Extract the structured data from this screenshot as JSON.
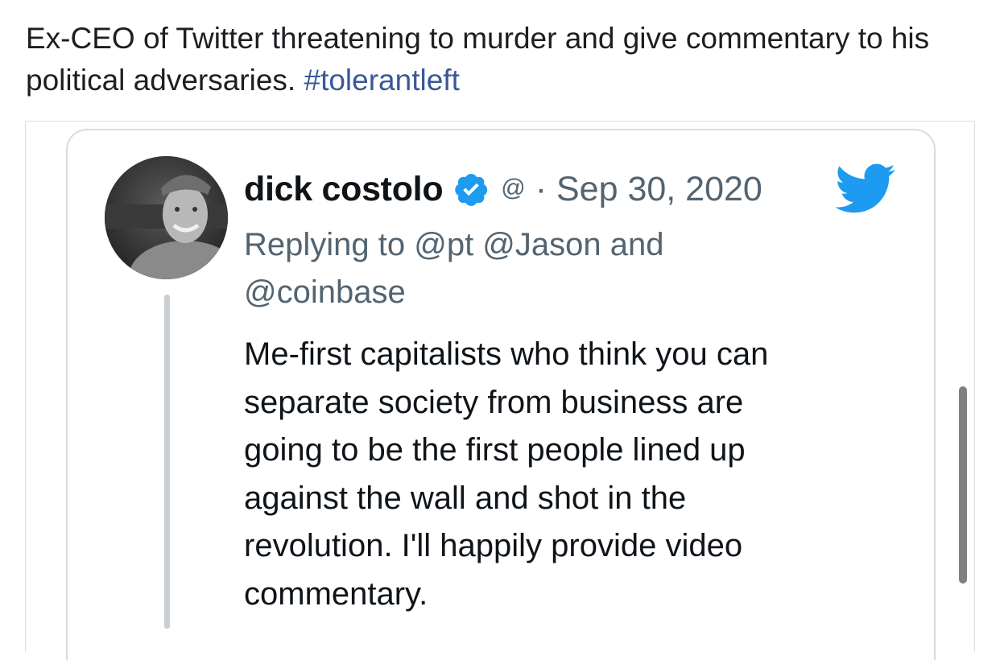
{
  "post": {
    "caption": "Ex-CEO of Twitter threatening to murder and give commentary to his political adversaries.",
    "hashtag": "#tolerantleft"
  },
  "tweet": {
    "author_name": "dick costolo",
    "handle": "@",
    "separator": "·",
    "date": "Sep 30, 2020",
    "replying_to_line1": "Replying to @pt @Jason and",
    "replying_to_line2": "@coinbase",
    "body_lines": [
      "Me-first capitalists who think you can",
      "separate society from business are",
      "going to be the first people lined up",
      "against the wall and shot in the",
      "revolution. I'll happily provide video",
      "commentary."
    ],
    "verified_icon": "verified-badge-icon",
    "brand_icon": "twitter-bird-icon"
  },
  "colors": {
    "hashtag": "#385898",
    "twitter_blue": "#1d9bf0",
    "secondary_text": "#536471"
  }
}
